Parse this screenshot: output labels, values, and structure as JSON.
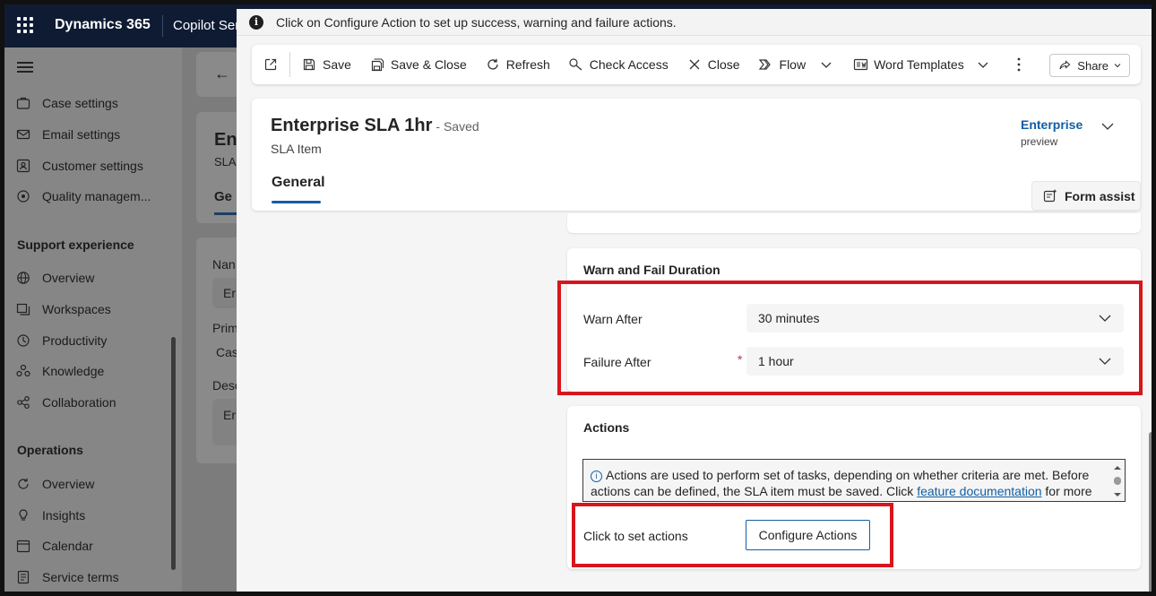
{
  "colors": {
    "accent": "#115ea3",
    "highlight": "#d7161d",
    "topbar": "#0f1b33",
    "required": "#c4314b"
  },
  "app": {
    "name": "Dynamics 365",
    "subtitle": "Copilot Ser"
  },
  "sidebar": {
    "items_top": [
      {
        "label": "Case settings",
        "icon": "briefcase-icon"
      },
      {
        "label": "Email settings",
        "icon": "mail-icon"
      },
      {
        "label": "Customer settings",
        "icon": "contact-card-icon"
      },
      {
        "label": "Quality managem...",
        "icon": "quality-icon"
      }
    ],
    "group1_heading": "Support experience",
    "group1_items": [
      {
        "label": "Overview",
        "icon": "globe-icon"
      },
      {
        "label": "Workspaces",
        "icon": "workspaces-icon"
      },
      {
        "label": "Productivity",
        "icon": "productivity-icon"
      },
      {
        "label": "Knowledge",
        "icon": "knowledge-icon"
      },
      {
        "label": "Collaboration",
        "icon": "collaboration-icon"
      }
    ],
    "group2_heading": "Operations",
    "group2_items": [
      {
        "label": "Overview",
        "icon": "refresh-circle-icon"
      },
      {
        "label": "Insights",
        "icon": "lightbulb-icon"
      },
      {
        "label": "Calendar",
        "icon": "calendar-icon"
      },
      {
        "label": "Service terms",
        "icon": "document-icon"
      }
    ]
  },
  "background": {
    "title_partial": "En",
    "entity_partial": "SLA",
    "tab_partial": "Ge",
    "field1_label": "Nan",
    "field1_value": "Er",
    "field2_label": "Prim",
    "field2_value": "Cas",
    "field3_label": "Desc",
    "field3_value": "Er"
  },
  "infobar": {
    "text": "Click on Configure Action to set up success, warning and failure actions."
  },
  "commands": {
    "save": "Save",
    "save_close": "Save & Close",
    "refresh": "Refresh",
    "check_access": "Check Access",
    "close": "Close",
    "flow": "Flow",
    "word_templates": "Word Templates",
    "share": "Share"
  },
  "record": {
    "title": "Enterprise SLA 1hr",
    "saved_status": "- Saved",
    "entity": "SLA Item",
    "process_name": "Enterprise",
    "process_sub": "preview",
    "tab": "General",
    "form_assist": "Form assist"
  },
  "warn_fail": {
    "title": "Warn and Fail Duration",
    "warn_label": "Warn After",
    "warn_value": "30 minutes",
    "fail_label": "Failure After",
    "required_mark": "*",
    "fail_value": "1 hour"
  },
  "actions": {
    "title": "Actions",
    "info_prefix": "Actions are used to perform set of tasks, depending on whether criteria are met. Before actions can be defined, the SLA item must be saved. Click ",
    "info_link": "feature documentation",
    "info_suffix": " for more",
    "set_label": "Click to set actions",
    "configure_button": "Configure Actions"
  }
}
